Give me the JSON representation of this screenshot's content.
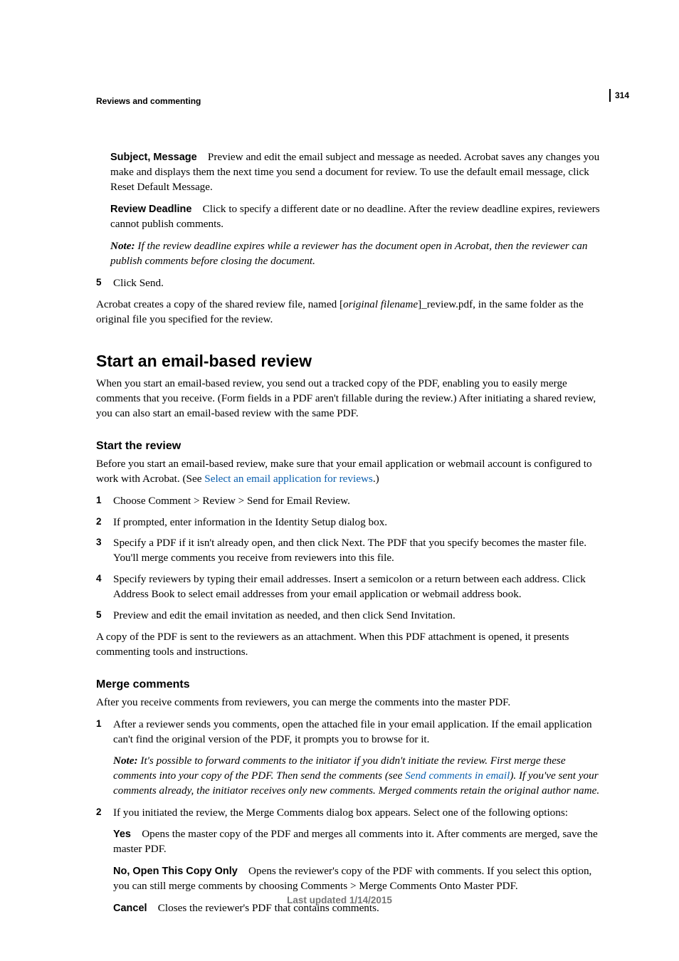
{
  "pageNumber": "314",
  "chapterTitle": "Reviews and commenting",
  "subjectMessage": {
    "term": "Subject, Message",
    "desc": "Preview and edit the email subject and message as needed. Acrobat saves any changes you make and displays them the next time you send a document for review. To use the default email message, click Reset Default Message."
  },
  "reviewDeadline": {
    "term": "Review Deadline",
    "desc": "Click to specify a different date or no deadline. After the review deadline expires, reviewers cannot publish comments."
  },
  "deadlineNote": {
    "label": "Note: ",
    "body": "If the review deadline expires while a reviewer has the document open in Acrobat, then the reviewer can publish comments before closing the document."
  },
  "step5": {
    "num": "5",
    "text": "Click Send."
  },
  "afterSend": {
    "pre": "Acrobat creates a copy of the shared review file, named [",
    "italic": "original filename",
    "post": "]_review.pdf, in the same folder as the original file you specified for the review."
  },
  "h2": "Start an email-based review",
  "introPara": "When you start an email-based review, you send out a tracked copy of the PDF, enabling you to easily merge comments that you receive. (Form fields in a PDF aren't fillable during the review.) After initiating a shared review, you can also start an email-based review with the same PDF.",
  "h3a": "Start the review",
  "startPara": {
    "pre": "Before you start an email-based review, make sure that your email application or webmail account is configured to work with Acrobat. (See ",
    "link": "Select an email application for reviews",
    "post": ".)"
  },
  "startSteps": {
    "s1": {
      "num": "1",
      "text": "Choose Comment > Review > Send for Email Review."
    },
    "s2": {
      "num": "2",
      "text": "If prompted, enter information in the Identity Setup dialog box."
    },
    "s3": {
      "num": "3",
      "text": "Specify a PDF if it isn't already open, and then click Next. The PDF that you specify becomes the master file. You'll merge comments you receive from reviewers into this file."
    },
    "s4": {
      "num": "4",
      "text": "Specify reviewers by typing their email addresses. Insert a semicolon or a return between each address. Click Address Book to select email addresses from your email application or webmail address book."
    },
    "s5": {
      "num": "5",
      "text": "Preview and edit the email invitation as needed, and then click Send Invitation."
    }
  },
  "startResult": "A copy of the PDF is sent to the reviewers as an attachment. When this PDF attachment is opened, it presents commenting tools and instructions.",
  "h3b": "Merge comments",
  "mergeIntro": "After you receive comments from reviewers, you can merge the comments into the master PDF.",
  "mergeSteps": {
    "s1": {
      "num": "1",
      "text": "After a reviewer sends you comments, open the attached file in your email application. If the email application can't find the original version of the PDF, it prompts you to browse for it."
    },
    "note": {
      "label": "Note: ",
      "pre": "It's possible to forward comments to the initiator if you didn't initiate the review. First merge these comments into your copy of the PDF. Then send the comments (see ",
      "link": "Send comments in email",
      "post": "). If you've sent your comments already, the initiator receives only new comments. Merged comments retain the original author name."
    },
    "s2": {
      "num": "2",
      "text": "If you initiated the review, the Merge Comments dialog box appears. Select one of the following options:"
    },
    "optYes": {
      "term": "Yes",
      "desc": "Opens the master copy of the PDF and merges all comments into it. After comments are merged, save the master PDF."
    },
    "optNo": {
      "term": "No, Open This Copy Only",
      "desc": "Opens the reviewer's copy of the PDF with comments. If you select this option, you can still merge comments by choosing Comments > Merge Comments Onto Master PDF."
    },
    "optCancel": {
      "term": "Cancel",
      "desc": "Closes the reviewer's PDF that contains comments."
    }
  },
  "footer": "Last updated 1/14/2015"
}
